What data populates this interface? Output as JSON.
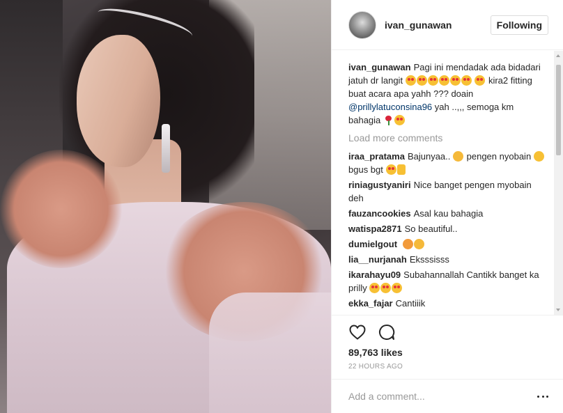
{
  "header": {
    "username": "ivan_gunawan",
    "follow_label": "Following"
  },
  "caption": {
    "user": "ivan_gunawan",
    "text1": "Pagi ini mendadak ada bidadari jatuh dr langit",
    "text2": "kira2 fitting buat acara apa yahh ??? doain",
    "mention": "@prillylatuconsina96",
    "text3": "yah ..,,, semoga km bahagia"
  },
  "load_more": "Load more comments",
  "comments": [
    {
      "user": "iraa_pratama",
      "text": "Bajunyaa..",
      "text_b": "pengen nyobain",
      "text_c": "bgus bgt"
    },
    {
      "user": "riniagustyaniri",
      "text": "Nice banget pengen myobain deh"
    },
    {
      "user": "fauzancookies",
      "text": "Asal kau bahagia"
    },
    {
      "user": "watispa2871",
      "text": "So beautiful.."
    },
    {
      "user": "dumielgout",
      "text": ""
    },
    {
      "user": "lia__nurjanah",
      "text": "Eksssisss"
    },
    {
      "user": "ikarahayu09",
      "text": "Subahannallah Cantikk banget ka prilly"
    },
    {
      "user": "ekka_fajar",
      "text": "Cantiiik"
    }
  ],
  "likes": "89,763 likes",
  "time": "22 HOURS AGO",
  "add_comment_placeholder": "Add a comment...",
  "icons": {
    "like": "heart-icon",
    "comment": "comment-bubble-icon",
    "more": "more-options-icon"
  }
}
